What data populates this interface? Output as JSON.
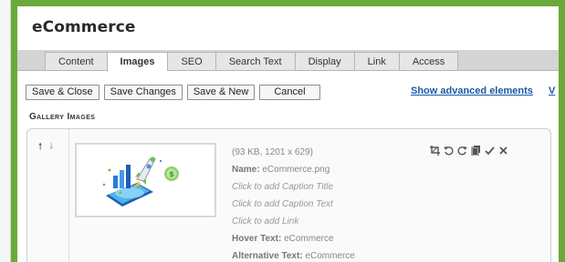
{
  "page": {
    "title": "eCommerce"
  },
  "tabs": [
    "Content",
    "Images",
    "SEO",
    "Search Text",
    "Display",
    "Link",
    "Access"
  ],
  "active_tab": "Images",
  "toolbar": {
    "save_close": "Save & Close",
    "save_changes": "Save Changes",
    "save_new": "Save & New",
    "cancel": "Cancel"
  },
  "advanced_link": "Show advanced elements",
  "truncated_link": "V",
  "gallery": {
    "title": "Gallery Images",
    "images": [
      {
        "file_info": "(93 KB, 1201 x 629)",
        "name_label": "Name:",
        "name_value": "eCommerce.png",
        "caption_title_placeholder": "Click to add Caption Title",
        "caption_text_placeholder": "Click to add Caption Text",
        "link_placeholder": "Click to add Link",
        "hover_label": "Hover Text:",
        "hover_value": "eCommerce",
        "alt_label": "Alternative Text:",
        "alt_value": "eCommerce"
      }
    ]
  },
  "icons": {
    "move_up": "arrow-up-icon",
    "move_down": "arrow-down-icon",
    "crop": "crop-icon",
    "rotate_left": "rotate-left-icon",
    "rotate_right": "rotate-right-icon",
    "copy": "copy-icon",
    "confirm": "check-icon",
    "delete": "close-icon"
  },
  "colors": {
    "frame_border": "#6aaa3a",
    "tab_bar": "#d4d4d4",
    "link": "#1a5aa6"
  }
}
